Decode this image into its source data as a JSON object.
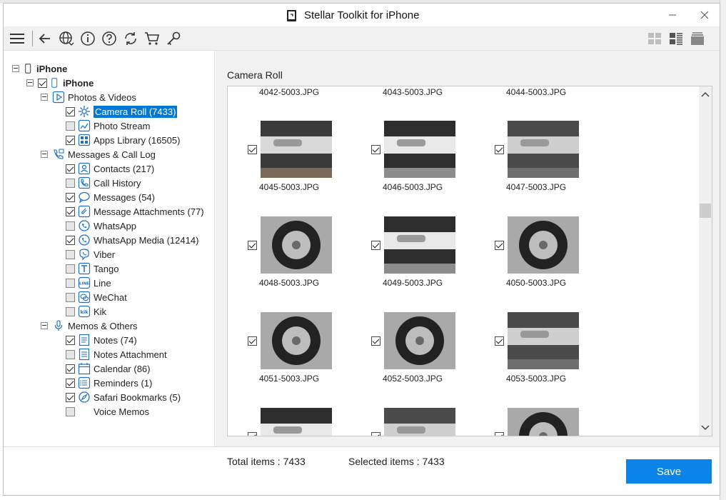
{
  "window": {
    "title": "Stellar Toolkit for iPhone"
  },
  "toolbar": {
    "icons": [
      "menu-icon",
      "back-icon",
      "globe-icon",
      "info-icon",
      "help-icon",
      "refresh-icon",
      "cart-icon",
      "key-icon",
      "grid-view-icon",
      "list-view-icon",
      "stack-view-icon"
    ]
  },
  "tree": {
    "root": "iPhone",
    "device": "iPhone",
    "groups": [
      {
        "label": "Photos & Videos",
        "items": [
          {
            "label": "Camera Roll (7433)",
            "checked": true,
            "selected": true,
            "icon": "camera-roll-icon"
          },
          {
            "label": "Photo Stream",
            "checked": false,
            "icon": "photo-stream-icon"
          },
          {
            "label": "Apps Library (16505)",
            "checked": true,
            "icon": "apps-library-icon"
          }
        ]
      },
      {
        "label": "Messages & Call Log",
        "items": [
          {
            "label": "Contacts (217)",
            "checked": true,
            "icon": "contacts-icon"
          },
          {
            "label": "Call History",
            "checked": false,
            "icon": "call-history-icon"
          },
          {
            "label": "Messages (54)",
            "checked": true,
            "icon": "messages-icon"
          },
          {
            "label": "Message Attachments (77)",
            "checked": true,
            "icon": "attachment-icon"
          },
          {
            "label": "WhatsApp",
            "checked": false,
            "icon": "whatsapp-icon"
          },
          {
            "label": "WhatsApp Media (12414)",
            "checked": true,
            "icon": "whatsapp-media-icon"
          },
          {
            "label": "Viber",
            "checked": false,
            "icon": "viber-icon"
          },
          {
            "label": "Tango",
            "checked": false,
            "icon": "tango-icon"
          },
          {
            "label": "Line",
            "checked": false,
            "icon": "line-icon"
          },
          {
            "label": "WeChat",
            "checked": false,
            "icon": "wechat-icon"
          },
          {
            "label": "Kik",
            "checked": false,
            "icon": "kik-icon"
          }
        ]
      },
      {
        "label": "Memos & Others",
        "items": [
          {
            "label": "Notes (74)",
            "checked": true,
            "icon": "notes-icon"
          },
          {
            "label": "Notes Attachment",
            "checked": false,
            "icon": "notes-attachment-icon"
          },
          {
            "label": "Calendar (86)",
            "checked": true,
            "icon": "calendar-icon"
          },
          {
            "label": "Reminders (1)",
            "checked": true,
            "icon": "reminders-icon"
          },
          {
            "label": "Safari Bookmarks (5)",
            "checked": true,
            "icon": "safari-icon"
          },
          {
            "label": "Voice Memos",
            "checked": false,
            "icon": "voice-memos-icon"
          }
        ]
      }
    ]
  },
  "gallery": {
    "title": "Camera Roll",
    "partial_top_names": [
      "4042-5003.JPG",
      "4043-5003.JPG",
      "4044-5003.JPG"
    ],
    "rows": [
      [
        "4045-5003.JPG",
        "4046-5003.JPG",
        "4047-5003.JPG"
      ],
      [
        "4048-5003.JPG",
        "4049-5003.JPG",
        "4050-5003.JPG"
      ],
      [
        "4051-5003.JPG",
        "4052-5003.JPG",
        "4053-5003.JPG"
      ]
    ]
  },
  "footer": {
    "total_items": "Total items : 7433",
    "selected_items": "Selected items : 7433",
    "save_label": "Save"
  },
  "colors": {
    "accent": "#0a84e8",
    "selection": "#0078d7"
  }
}
